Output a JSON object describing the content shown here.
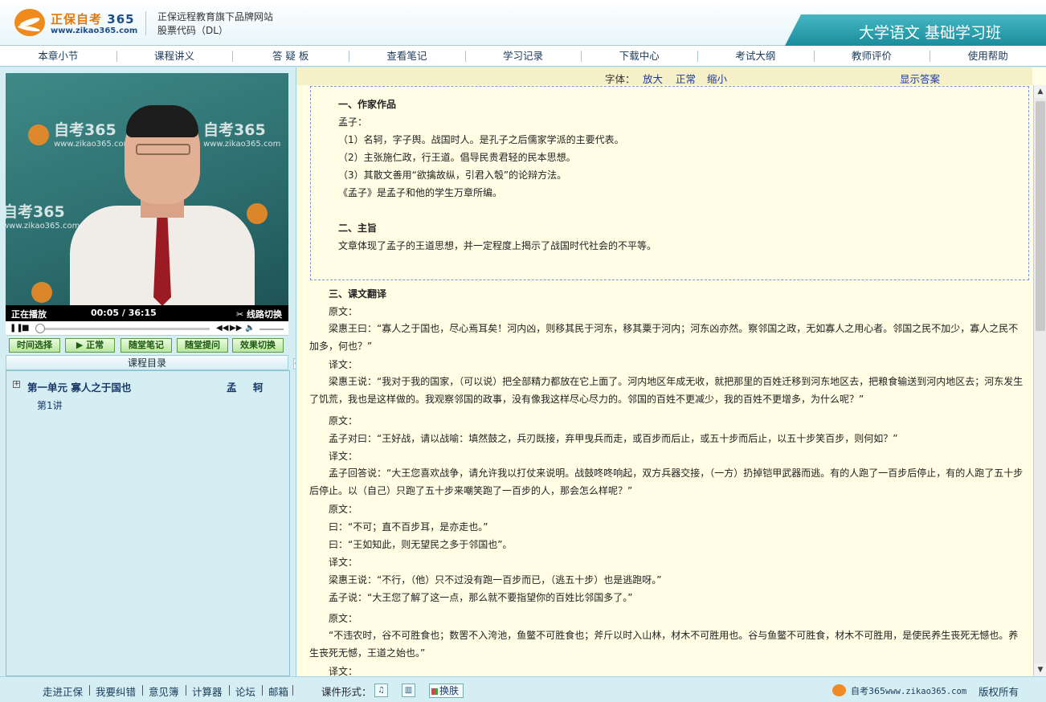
{
  "header": {
    "logo_brand": "正保",
    "logo_name": "自考",
    "logo_num": "365",
    "logo_url": "www.zikao365.com",
    "subtitle1": "正保远程教育旗下品牌网站",
    "subtitle2": "股票代码（DL）",
    "course_title": "大学语文 基础学习班"
  },
  "nav": [
    "本章小节",
    "课程讲义",
    "答 疑 板",
    "查看笔记",
    "学习记录",
    "下载中心",
    "考试大纲",
    "教师评价",
    "使用帮助"
  ],
  "video": {
    "watermark_text": "自考365",
    "watermark_url": "www.zikao365.com",
    "status": "正在播放",
    "current_time": "00:05",
    "time_sep": "/",
    "total_time": "36:15",
    "line_switch": "线路切换",
    "progress_fraction": 0.014
  },
  "video_buttons": [
    "时间选择",
    "正常",
    "随堂笔记",
    "随堂提问",
    "效果切换"
  ],
  "toc": {
    "title": "课程目录",
    "unit": "第一单元 寡人之于国也",
    "author": "孟 轲",
    "lesson": "第1讲"
  },
  "font_bar": {
    "label": "字体：",
    "larger": "放大",
    "normal": "正常",
    "smaller": "缩小",
    "show_answer": "显示答案"
  },
  "content": {
    "s1_title": "一、作家作品",
    "s1_l1": "孟子：",
    "s1_l2": "（1）名轲，字子舆。战国时人。是孔子之后儒家学派的主要代表。",
    "s1_l3": "（2）主张施仁政，行王道。倡导民贵君轻的民本思想。",
    "s1_l4": "（3）其散文善用“欲擒故纵，引君入彀”的论辩方法。",
    "s1_l5": "《孟子》是孟子和他的学生万章所编。",
    "s2_title": "二、主旨",
    "s2_l1": "文章体现了孟子的王道思想，并一定程度上揭示了战国时代社会的不平等。",
    "s3_title": "三、课文翻译",
    "yuanwen": "原文：",
    "yiwen": "译文：",
    "p1": "梁惠王曰：“寡人之于国也，尽心焉耳矣！河内凶，则移其民于河东，移其粟于河内；河东凶亦然。察邻国之政，无如寡人之用心者。邻国之民不加少，寡人之民不加多，何也？”",
    "p2": "梁惠王说：“我对于我的国家，（可以说）把全部精力都放在它上面了。河内地区年成无收，就把那里的百姓迁移到河东地区去，把粮食输送到河内地区去；河东发生了饥荒，我也是这样做的。我观察邻国的政事，没有像我这样尽心尽力的。邻国的百姓不更减少，我的百姓不更增多，为什么呢？”",
    "p3": "孟子对曰：“王好战，请以战喻：填然鼓之，兵刃既接，弃甲曳兵而走，或百步而后止，或五十步而后止，以五十步笑百步，则何如？”",
    "p4": "孟子回答说：“大王您喜欢战争，请允许我以打仗来说明。战鼓咚咚响起，双方兵器交接，（一方）扔掉铠甲武器而逃。有的人跑了一百步后停止，有的人跑了五十步后停止。以（自己）只跑了五十步来嘲笑跑了一百步的人，那会怎么样呢？”",
    "p5": "曰：“不可；直不百步耳，是亦走也。”",
    "p6": "曰：“王如知此，则无望民之多于邻国也”。",
    "p7": "梁惠王说：“不行，（他）只不过没有跑一百步而已，（逃五十步）也是逃跑呀。”",
    "p8": "孟子说：“大王您了解了这一点，那么就不要指望你的百姓比邻国多了。”",
    "p9": "“不违农时，谷不可胜食也；数罟不入洿池，鱼鳖不可胜食也；斧斤以时入山林，材木不可胜用也。谷与鱼鳖不可胜食，材木不可胜用，是使民养生丧死无憾也。养生丧死无憾，王道之始也。”"
  },
  "footer": {
    "links": [
      "走进正保",
      "我要纠错",
      "意见簿",
      "计算器",
      "论坛",
      "邮箱"
    ],
    "format_label": "课件形式：",
    "skin": "换肤",
    "site_name": "自考365",
    "site_url": "www.zikao365.com",
    "copyright": "版权所有"
  }
}
